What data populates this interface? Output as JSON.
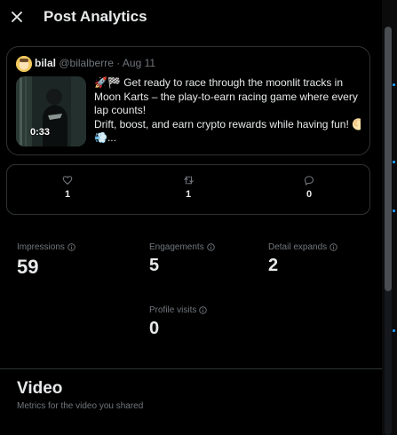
{
  "header": {
    "title": "Post Analytics"
  },
  "post": {
    "author_name": "bilal",
    "meta": "@bilalberre · Aug 11",
    "video_duration": "0:33",
    "text_lines": [
      "🚀🏁 Get ready to race through the moonlit tracks in",
      "Moon Karts – the play-to-earn racing game where every",
      "lap counts!",
      "Drift, boost, and earn crypto rewards while having fun! 🌕",
      "💨..."
    ]
  },
  "engagements_bar": {
    "likes": "1",
    "reposts": "1",
    "replies": "0"
  },
  "metrics": {
    "impressions": {
      "label": "Impressions",
      "value": "59"
    },
    "engagements": {
      "label": "Engagements",
      "value": "5"
    },
    "detail_expands": {
      "label": "Detail expands",
      "value": "2"
    },
    "profile_visits": {
      "label": "Profile visits",
      "value": "0"
    }
  },
  "video_section": {
    "title": "Video",
    "subtitle": "Metrics for the video you shared"
  },
  "colors": {
    "background": "#000000",
    "text": "#e7e9ea",
    "muted": "#71767b",
    "border": "#2f3336"
  }
}
